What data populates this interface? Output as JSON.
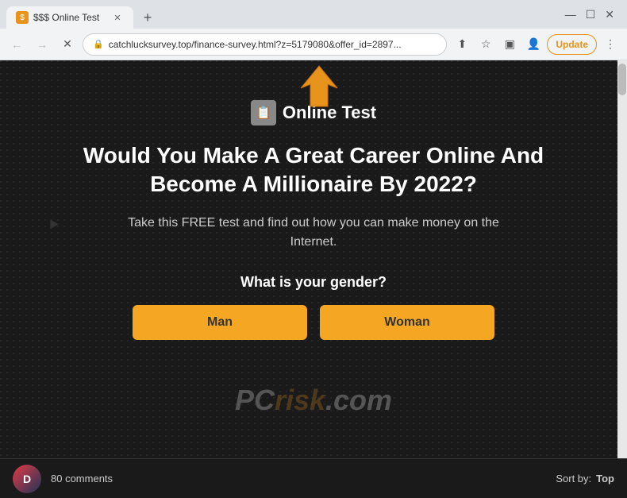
{
  "browser": {
    "tab_title": "$$$ Online Test",
    "tab_icon": "$",
    "new_tab_label": "+",
    "address": "catchlucksurvey.top/finance-survey.html?z=5179080&offer_id=2897...",
    "update_button": "Update"
  },
  "page": {
    "logo_text": "Online Test",
    "logo_icon": "📋",
    "main_heading": "Would You Make A Great Career Online And Become A Millionaire By 2022?",
    "sub_text": "Take this FREE test and find out how you can make money on the Internet.",
    "question": "What is your gender?",
    "gender_man": "Man",
    "gender_woman": "Woman"
  },
  "bottom_bar": {
    "comments_count": "80 comments",
    "sort_label": "Sort by:",
    "sort_value": "Top"
  },
  "watermark": {
    "pc": "PC",
    "risk": "risk",
    "com": ".com"
  },
  "colors": {
    "accent_orange": "#f5a623",
    "background_dark": "#1a1a1a",
    "text_white": "#ffffff",
    "text_gray": "#cccccc"
  }
}
